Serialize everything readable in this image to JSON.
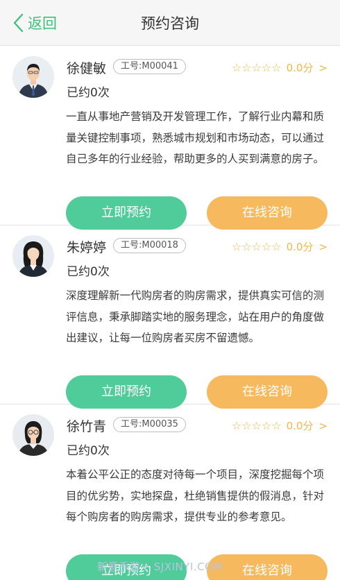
{
  "header": {
    "back_label": "返回",
    "title": "预约咨询"
  },
  "colors": {
    "accent_green": "#3cc17a",
    "book_button": "#50cc9b",
    "consult_button": "#f7b95d",
    "star": "#f0b64a"
  },
  "consultants": [
    {
      "name": "徐健敏",
      "badge": "工号:M00041",
      "stars": "☆☆☆☆☆",
      "score": "0.0分",
      "booked": "已约0次",
      "description": "一直从事地产营销及开发管理工作，了解行业内幕和质量关键控制事项，熟悉城市规划和市场动态，可以通过自己多年的行业经验，帮助更多的人买到满意的房子。",
      "book_label": "立即预约",
      "consult_label": "在线咨询",
      "avatar_icon": "male-consultant-avatar"
    },
    {
      "name": "朱婷婷",
      "badge": "工号:M00018",
      "stars": "☆☆☆☆☆",
      "score": "0.0分",
      "booked": "已约0次",
      "description": "深度理解新一代购房者的购房需求，提供真实可信的测评信息，秉承脚踏实地的服务理念，站在用户的角度做出建议，让每一位购房者买房不留遗憾。",
      "book_label": "立即预约",
      "consult_label": "在线咨询",
      "avatar_icon": "female-consultant-avatar"
    },
    {
      "name": "徐竹青",
      "badge": "工号:M00035",
      "stars": "☆☆☆☆☆",
      "score": "0.0分",
      "booked": "已约0次",
      "description": "本着公平公正的态度对待每一个项目，深度挖掘每个项目的优劣势，实地探盘，杜绝销售提供的假消息，针对每个购房者的购房需求，提供专业的参考意见。",
      "book_label": "立即预约",
      "consult_label": "在线咨询",
      "avatar_icon": "female-glasses-consultant-avatar"
    }
  ],
  "watermark": "新意手游 • SJXINYI.COM"
}
